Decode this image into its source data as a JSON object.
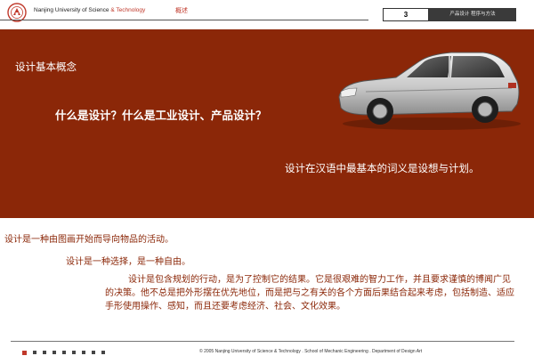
{
  "header": {
    "university": "Nanjing University of Science",
    "amp": "& Technology",
    "section": "概述",
    "page_number": "3",
    "chapter": "产品设计 程序与方法"
  },
  "banner": {
    "title": "设计基本概念",
    "question": "什么是设计？什么是工业设计、产品设计？",
    "note": "设计在汉语中最基本的词义是设想与计划。",
    "background_color": "#8b2708"
  },
  "content": {
    "line1": "设计是一种由图画开始而导向物品的活动。",
    "line2": "设计是一种选择，是一种自由。",
    "paragraph": "设计是包含规划的行动，是为了控制它的结果。它是很艰难的智力工作，并且要求谨慎的博闻广见的决策。他不总是把外形摆在优先地位，而是把与之有关的各个方面后果结合起来考虑，包括制造、适应手形使用操作、感知，而且还要考虑经济、社会、文化效果。",
    "text_color": "#8b2708"
  },
  "footer": {
    "nav_dots": 9,
    "active_dot": 0,
    "copyright": "© 2005 Nanjing University of Science & Technology . School of Mechanic Engineering . Department of Design Art"
  }
}
